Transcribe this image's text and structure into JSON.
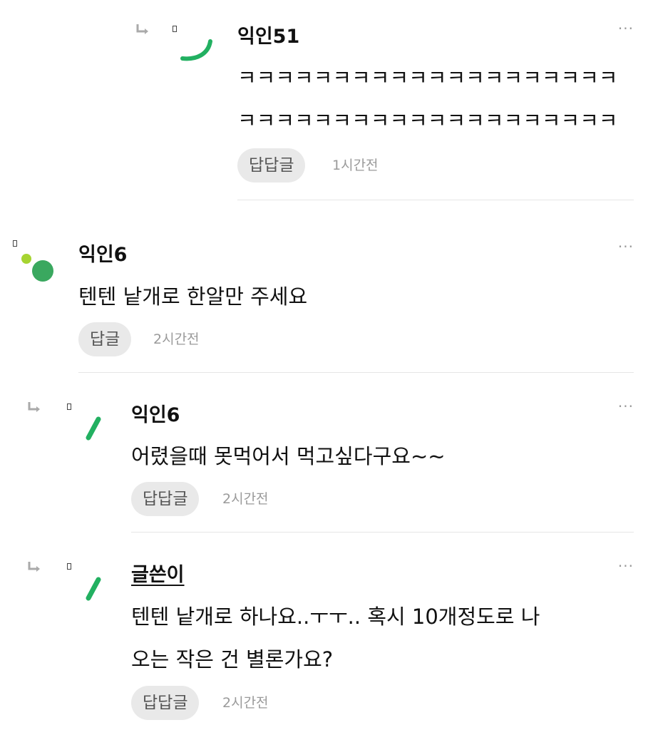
{
  "comments": [
    {
      "author": "익인51",
      "lines": [
        "ㅋㅋㅋㅋㅋㅋㅋㅋㅋㅋㅋㅋㅋㅋㅋㅋㅋㅋㅋㅋ",
        "ㅋㅋㅋㅋㅋㅋㅋㅋㅋㅋㅋㅋㅋㅋㅋㅋㅋㅋㅋㅋ"
      ],
      "reply_label": "답답글",
      "time": "1시간전",
      "more": "···"
    },
    {
      "author": "익인6",
      "lines": [
        "텐텐 낱개로 한알만 주세요"
      ],
      "reply_label": "답글",
      "time": "2시간전",
      "more": "···"
    },
    {
      "author": "익인6",
      "lines": [
        "어렸을때 못먹어서 먹고싶다구요~~"
      ],
      "reply_label": "답답글",
      "time": "2시간전",
      "more": "···"
    },
    {
      "author": "글쓴이",
      "lines": [
        "텐텐 낱개로 하나요..ㅜㅜ.. 혹시 10개정도로 나",
        "오는 작은 건 별론가요?"
      ],
      "reply_label": "답답글",
      "time": "2시간전",
      "more": "···"
    }
  ],
  "colors": {
    "accent_green": "#22b061",
    "avatar_green": "#3aa85f",
    "lime": "#a6d431"
  },
  "icons": {
    "reply_arrow": "reply-arrow-icon",
    "more": "more-dots-icon"
  }
}
